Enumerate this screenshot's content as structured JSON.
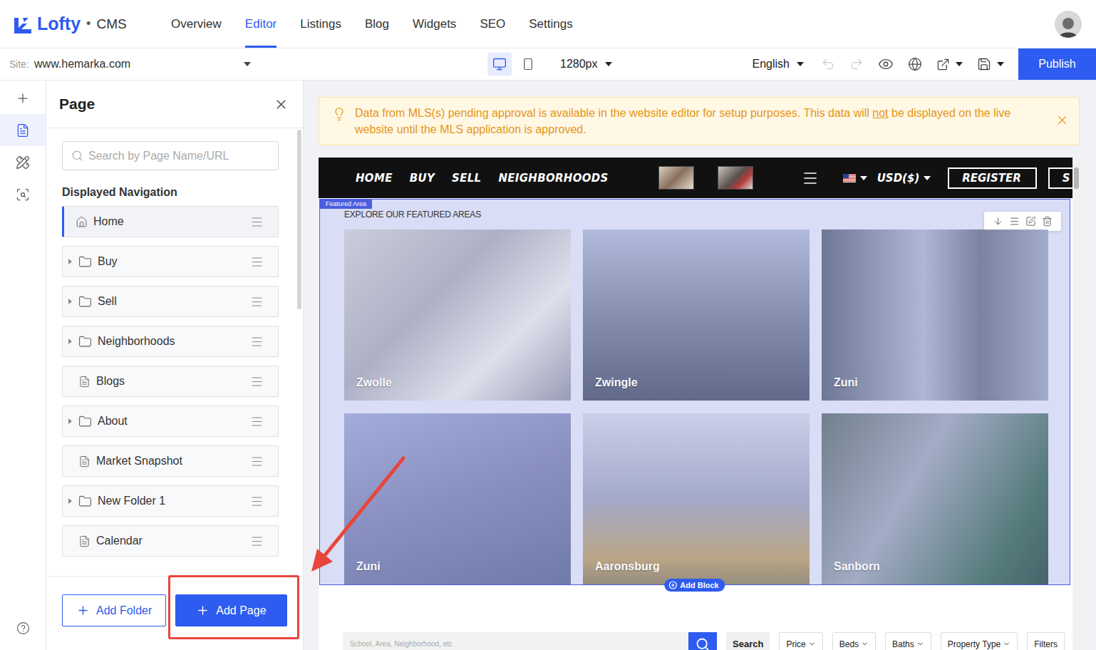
{
  "app": {
    "logo": "Lofty",
    "separator": "•",
    "product": "CMS"
  },
  "nav_tabs": [
    {
      "label": "Overview",
      "selected": false
    },
    {
      "label": "Editor",
      "selected": true
    },
    {
      "label": "Listings",
      "selected": false
    },
    {
      "label": "Blog",
      "selected": false
    },
    {
      "label": "Widgets",
      "selected": false
    },
    {
      "label": "SEO",
      "selected": false
    },
    {
      "label": "Settings",
      "selected": false
    }
  ],
  "toolbar": {
    "site_label": "Site:",
    "site": "www.hemarka.com",
    "devices": [
      {
        "kind": "desktop",
        "selected": true
      },
      {
        "kind": "mobile",
        "selected": false
      }
    ],
    "width": "1280px",
    "language": "English",
    "undo": {
      "disabled": true
    },
    "redo": {
      "disabled": true
    },
    "publish": "Publish"
  },
  "rail": [
    {
      "kind": "add",
      "selected": false
    },
    {
      "kind": "pages",
      "selected": true
    },
    {
      "kind": "design",
      "selected": false
    },
    {
      "kind": "preview",
      "selected": false
    }
  ],
  "panel": {
    "title": "Page",
    "search_placeholder": "Search by Page Name/URL",
    "section": "Displayed Navigation",
    "items": [
      {
        "label": "Home",
        "kind": "home",
        "selected": true
      },
      {
        "label": "Buy",
        "kind": "folder",
        "selected": false
      },
      {
        "label": "Sell",
        "kind": "folder",
        "selected": false
      },
      {
        "label": "Neighborhoods",
        "kind": "folder",
        "selected": false
      },
      {
        "label": "Blogs",
        "kind": "page",
        "selected": false
      },
      {
        "label": "About",
        "kind": "folder",
        "selected": false
      },
      {
        "label": "Market Snapshot",
        "kind": "page",
        "selected": false
      },
      {
        "label": "New Folder 1",
        "kind": "folder",
        "selected": false
      },
      {
        "label": "Calendar",
        "kind": "page",
        "selected": false
      }
    ],
    "buttons": [
      {
        "label": "Add Folder",
        "kind": "outline",
        "highlighted": false
      },
      {
        "label": "Add Page",
        "kind": "primary",
        "highlighted": true
      }
    ]
  },
  "banner": {
    "text_before": "Data from MLS(s) pending approval is available in the website editor for setup purposes. This data will ",
    "underlined": "not",
    "text_after": " be displayed on the live website until the MLS application is approved."
  },
  "preview": {
    "menu": [
      "HOME",
      "BUY",
      "SELL",
      "NEIGHBORHOODS"
    ],
    "currency": "USD($)",
    "register": "REGISTER",
    "cut_button": "S",
    "section_tag": "Featured Area",
    "heading": "EXPLORE OUR FEATURED AREAS",
    "areas": [
      "Zwolle",
      "Zwingle",
      "Zuni",
      "Zuni",
      "Aaronsburg",
      "Sanborn"
    ],
    "add_block": "Add Block",
    "search": {
      "placeholder": "School, Area, Neighborhood, etc",
      "button": "Search",
      "filters": [
        {
          "label": "Price",
          "dropdown": true
        },
        {
          "label": "Beds",
          "dropdown": true
        },
        {
          "label": "Baths",
          "dropdown": true
        },
        {
          "label": "Property Type",
          "dropdown": true
        },
        {
          "label": "Filters",
          "dropdown": false
        }
      ]
    }
  }
}
